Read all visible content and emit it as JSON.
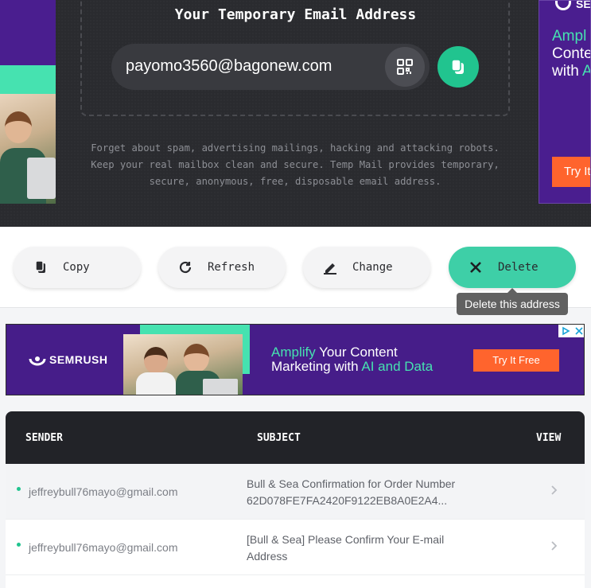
{
  "hero": {
    "title": "Your Temporary Email Address",
    "email": "payomo3560@bagonew.com",
    "description": "Forget about spam, advertising mailings, hacking and attacking robots. Keep your real mailbox clean and secure. Temp Mail provides temporary, secure, anonymous, free, disposable email address."
  },
  "side_ad": {
    "brand": "SEMRUSH",
    "line1": "Ampl",
    "line2": "Conte",
    "line3_prefix": "with ",
    "line3_accent": "A",
    "cta": "Try It"
  },
  "actions": {
    "copy": "Copy",
    "refresh": "Refresh",
    "change": "Change",
    "delete": "Delete",
    "delete_tooltip": "Delete this address"
  },
  "banner_ad": {
    "brand": "SEMRUSH",
    "line1_accent": "Amplify",
    "line1_rest": " Your Content",
    "line2_prefix": "Marketing with ",
    "line2_accent": "AI and Data",
    "cta": "Try It Free"
  },
  "inbox": {
    "columns": [
      "SENDER",
      "SUBJECT",
      "VIEW"
    ],
    "rows": [
      {
        "sender": "jeffreybull76mayo@gmail.com",
        "subject": "Bull & Sea Confirmation for Order Number 62D078FE7FA2420F9122EB8A0E2A4..."
      },
      {
        "sender": "jeffreybull76mayo@gmail.com",
        "subject": "[Bull & Sea] Please Confirm Your E-mail Address"
      }
    ]
  },
  "colors": {
    "accent": "#3ecfa7",
    "dark": "#2a2b2f",
    "ad_purple": "#461d89",
    "ad_orange": "#ff642d"
  }
}
